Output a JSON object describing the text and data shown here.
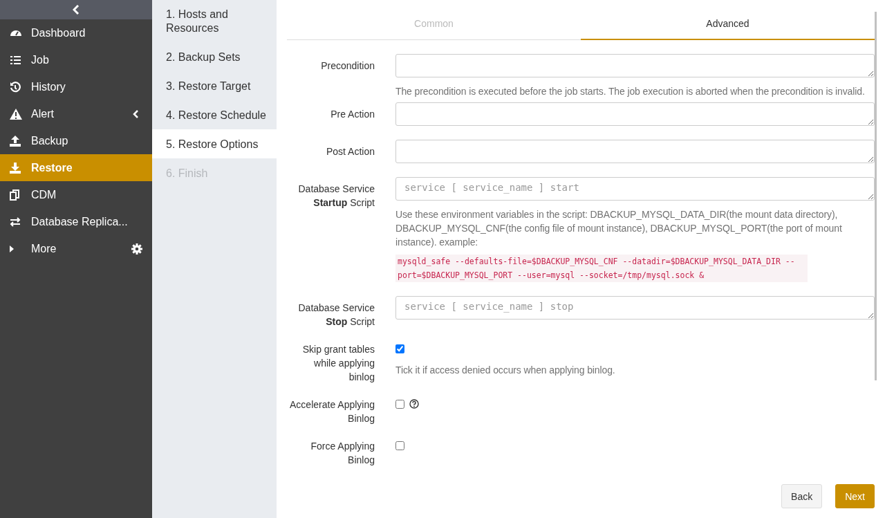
{
  "sidebar": {
    "items": [
      {
        "label": "Dashboard",
        "selected": false
      },
      {
        "label": "Job",
        "selected": false
      },
      {
        "label": "History",
        "selected": false
      },
      {
        "label": "Alert",
        "selected": false,
        "kind": "submenu",
        "expanded": false
      },
      {
        "label": "Backup",
        "selected": false
      },
      {
        "label": "Restore",
        "selected": true
      },
      {
        "label": "CDM",
        "selected": false
      },
      {
        "label": "Database Replica...",
        "selected": false
      },
      {
        "label": "More",
        "selected": false,
        "kind": "more"
      }
    ]
  },
  "steps": [
    {
      "label": "1. Hosts and Resources",
      "selected": false,
      "disabled": false
    },
    {
      "label": "2. Backup Sets",
      "selected": false,
      "disabled": false
    },
    {
      "label": "3. Restore Target",
      "selected": false,
      "disabled": false
    },
    {
      "label": "4. Restore Schedule",
      "selected": false,
      "disabled": false
    },
    {
      "label": "5. Restore Options",
      "selected": true,
      "disabled": false
    },
    {
      "label": "6. Finish",
      "selected": false,
      "disabled": true
    }
  ],
  "tabs": [
    {
      "label": "Common",
      "selected": false
    },
    {
      "label": "Advanced",
      "selected": true
    }
  ],
  "fields": [
    {
      "kind": "textarea",
      "label": "Precondition",
      "help": "The precondition is executed before the job starts. The job execution is aborted when the precondition is invalid."
    },
    {
      "kind": "textarea",
      "label": "Pre Action"
    },
    {
      "kind": "textarea",
      "label": "Post Action"
    },
    {
      "kind": "textarea",
      "label": "Database Service **Startup** Script",
      "placeholder": "service [ service_name ] start",
      "help": "Use these environment variables in the script: DBACKUP_MYSQL_DATA_DIR(the mount data directory), DBACKUP_MYSQL_CNF(the config file of mount instance), DBACKUP_MYSQL_PORT(the port of mount instance). example:",
      "code": "mysqld_safe --defaults-file=$DBACKUP_MYSQL_CNF --datadir=$DBACKUP_MYSQL_DATA_DIR --port=$DBACKUP_MYSQL_PORT --user=mysql --socket=/tmp/mysql.sock &"
    },
    {
      "kind": "textarea",
      "label": "Database Service **Stop** Script",
      "placeholder": "service [ service_name ] stop"
    },
    {
      "kind": "checkbox",
      "label": "Skip grant tables while applying binlog",
      "checked": true,
      "help": "Tick it if access denied occurs when applying binlog."
    },
    {
      "kind": "checkbox",
      "label": "Accelerate Applying Binlog",
      "checked": false,
      "info": true
    },
    {
      "kind": "checkbox",
      "label": "Force Applying Binlog",
      "checked": false
    }
  ],
  "buttons": [
    {
      "label": "Back",
      "kind": "secondary"
    },
    {
      "label": "Next",
      "kind": "primary"
    }
  ]
}
